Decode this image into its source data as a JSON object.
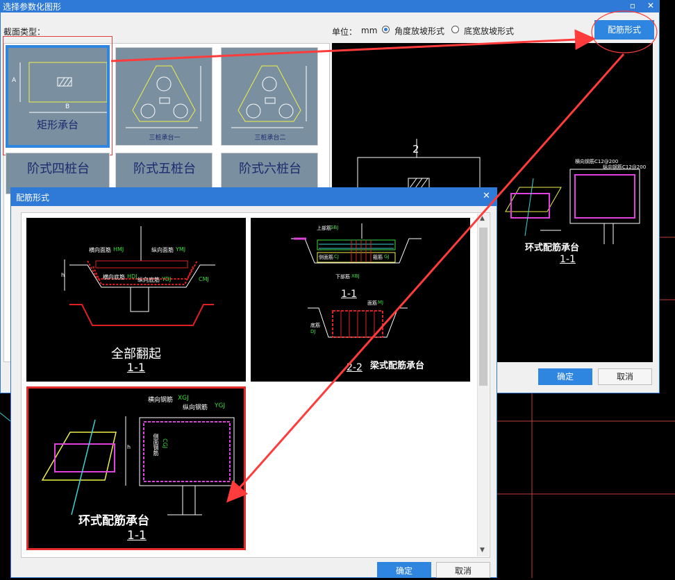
{
  "outer_dialog": {
    "title": "选择参数化图形",
    "section_type_label": "截面类型：",
    "unit_label": "单位：",
    "unit_value": "mm",
    "slope_options": [
      {
        "label": "角度放坡形式",
        "selected": true
      },
      {
        "label": "底宽放坡形式",
        "selected": false
      }
    ],
    "reinforce_button": "配筋形式",
    "ok_button": "确定",
    "cancel_button": "取消",
    "thumbnails": [
      {
        "label": "矩形承台",
        "dim_a": "A",
        "dim_b": "B",
        "selected": true
      },
      {
        "label": "三桩承台一",
        "selected": false
      },
      {
        "label": "三桩承台二",
        "selected": false
      },
      {
        "label": "阶式四桩台",
        "selected": false
      },
      {
        "label": "阶式五桩台",
        "selected": false
      },
      {
        "label": "阶式六桩台",
        "selected": false
      }
    ],
    "preview": {
      "section_no": "2",
      "title": "环式配筋承台",
      "section": "1-1",
      "label_h": "横向钢筋C12@200",
      "label_v": "纵向钢筋C12@200"
    }
  },
  "inner_dialog": {
    "title": "配筋形式",
    "ok_button": "确定",
    "cancel_button": "取消",
    "options": [
      {
        "title": "全部翻起",
        "section": "1-1",
        "labels": {
          "top_h": "横向面筋",
          "top_h_code": "HMJ",
          "top_v": "纵向面筋",
          "top_v_code": "YMJ",
          "bot_h": "横向底筋",
          "bot_h_code": "HDJ",
          "bot_v": "纵向底筋",
          "bot_v_code": "YDJ",
          "cmj": "CMJ",
          "h": "h"
        },
        "selected": false
      },
      {
        "title": "梁式配筋承台",
        "sections": [
          "1-1",
          "2-2"
        ],
        "labels": {
          "top": "上部筋",
          "top_code": "SBJ",
          "side": "侧面筋",
          "side_code": "CJ",
          "stirrup": "箍筋",
          "stirrup_code": "GJ",
          "bottom": "下部筋",
          "bottom_code": "XBJ",
          "face": "面筋",
          "face_code": "MJ",
          "bottom2": "底筋",
          "bottom2_code": "DJ"
        },
        "selected": false
      },
      {
        "title": "环式配筋承台",
        "section": "1-1",
        "labels": {
          "h_bar": "横向钢筋",
          "h_code": "XGJ",
          "v_bar": "纵向钢筋",
          "v_code": "YGJ",
          "side": "侧面钢筋",
          "side_code": "CGJ",
          "h": "h"
        },
        "selected": true
      }
    ]
  },
  "colors": {
    "accent": "#2f7ad6",
    "annotation": "#ff3b3b",
    "selection": "#e32b2b"
  }
}
